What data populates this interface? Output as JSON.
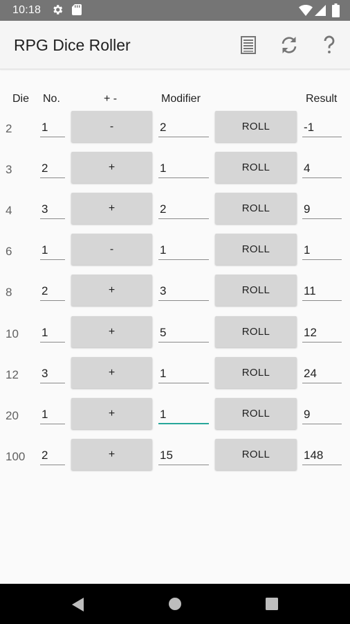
{
  "status_bar": {
    "time": "10:18"
  },
  "app_bar": {
    "title": "RPG Dice Roller"
  },
  "header": {
    "die": "Die",
    "no": "No.",
    "sign": "+ -",
    "modifier": "Modifier",
    "result": "Result"
  },
  "rows": [
    {
      "die": "2",
      "no": "1",
      "sign": "-",
      "modifier": "2",
      "roll": "ROLL",
      "result": "-1"
    },
    {
      "die": "3",
      "no": "2",
      "sign": "+",
      "modifier": "1",
      "roll": "ROLL",
      "result": "4"
    },
    {
      "die": "4",
      "no": "3",
      "sign": "+",
      "modifier": "2",
      "roll": "ROLL",
      "result": "9"
    },
    {
      "die": "6",
      "no": "1",
      "sign": "-",
      "modifier": "1",
      "roll": "ROLL",
      "result": "1"
    },
    {
      "die": "8",
      "no": "2",
      "sign": "+",
      "modifier": "3",
      "roll": "ROLL",
      "result": "11"
    },
    {
      "die": "10",
      "no": "1",
      "sign": "+",
      "modifier": "5",
      "roll": "ROLL",
      "result": "12"
    },
    {
      "die": "12",
      "no": "3",
      "sign": "+",
      "modifier": "1",
      "roll": "ROLL",
      "result": "24"
    },
    {
      "die": "20",
      "no": "1",
      "sign": "+",
      "modifier": "1",
      "roll": "ROLL",
      "result": "9",
      "focused": true
    },
    {
      "die": "100",
      "no": "2",
      "sign": "+",
      "modifier": "15",
      "roll": "ROLL",
      "result": "148"
    }
  ],
  "colors": {
    "status_bar": "#757575",
    "app_bar": "#f5f5f5",
    "button": "#d6d6d6",
    "focus_accent": "#26a69a",
    "nav_bar": "#000000"
  },
  "icons": {
    "app_bar": [
      "list-icon",
      "refresh-icon",
      "help-icon"
    ],
    "status": [
      "settings-icon",
      "sd-card-icon",
      "wifi-icon",
      "signal-icon",
      "battery-icon"
    ],
    "nav": [
      "back-icon",
      "home-icon",
      "recents-icon"
    ]
  }
}
